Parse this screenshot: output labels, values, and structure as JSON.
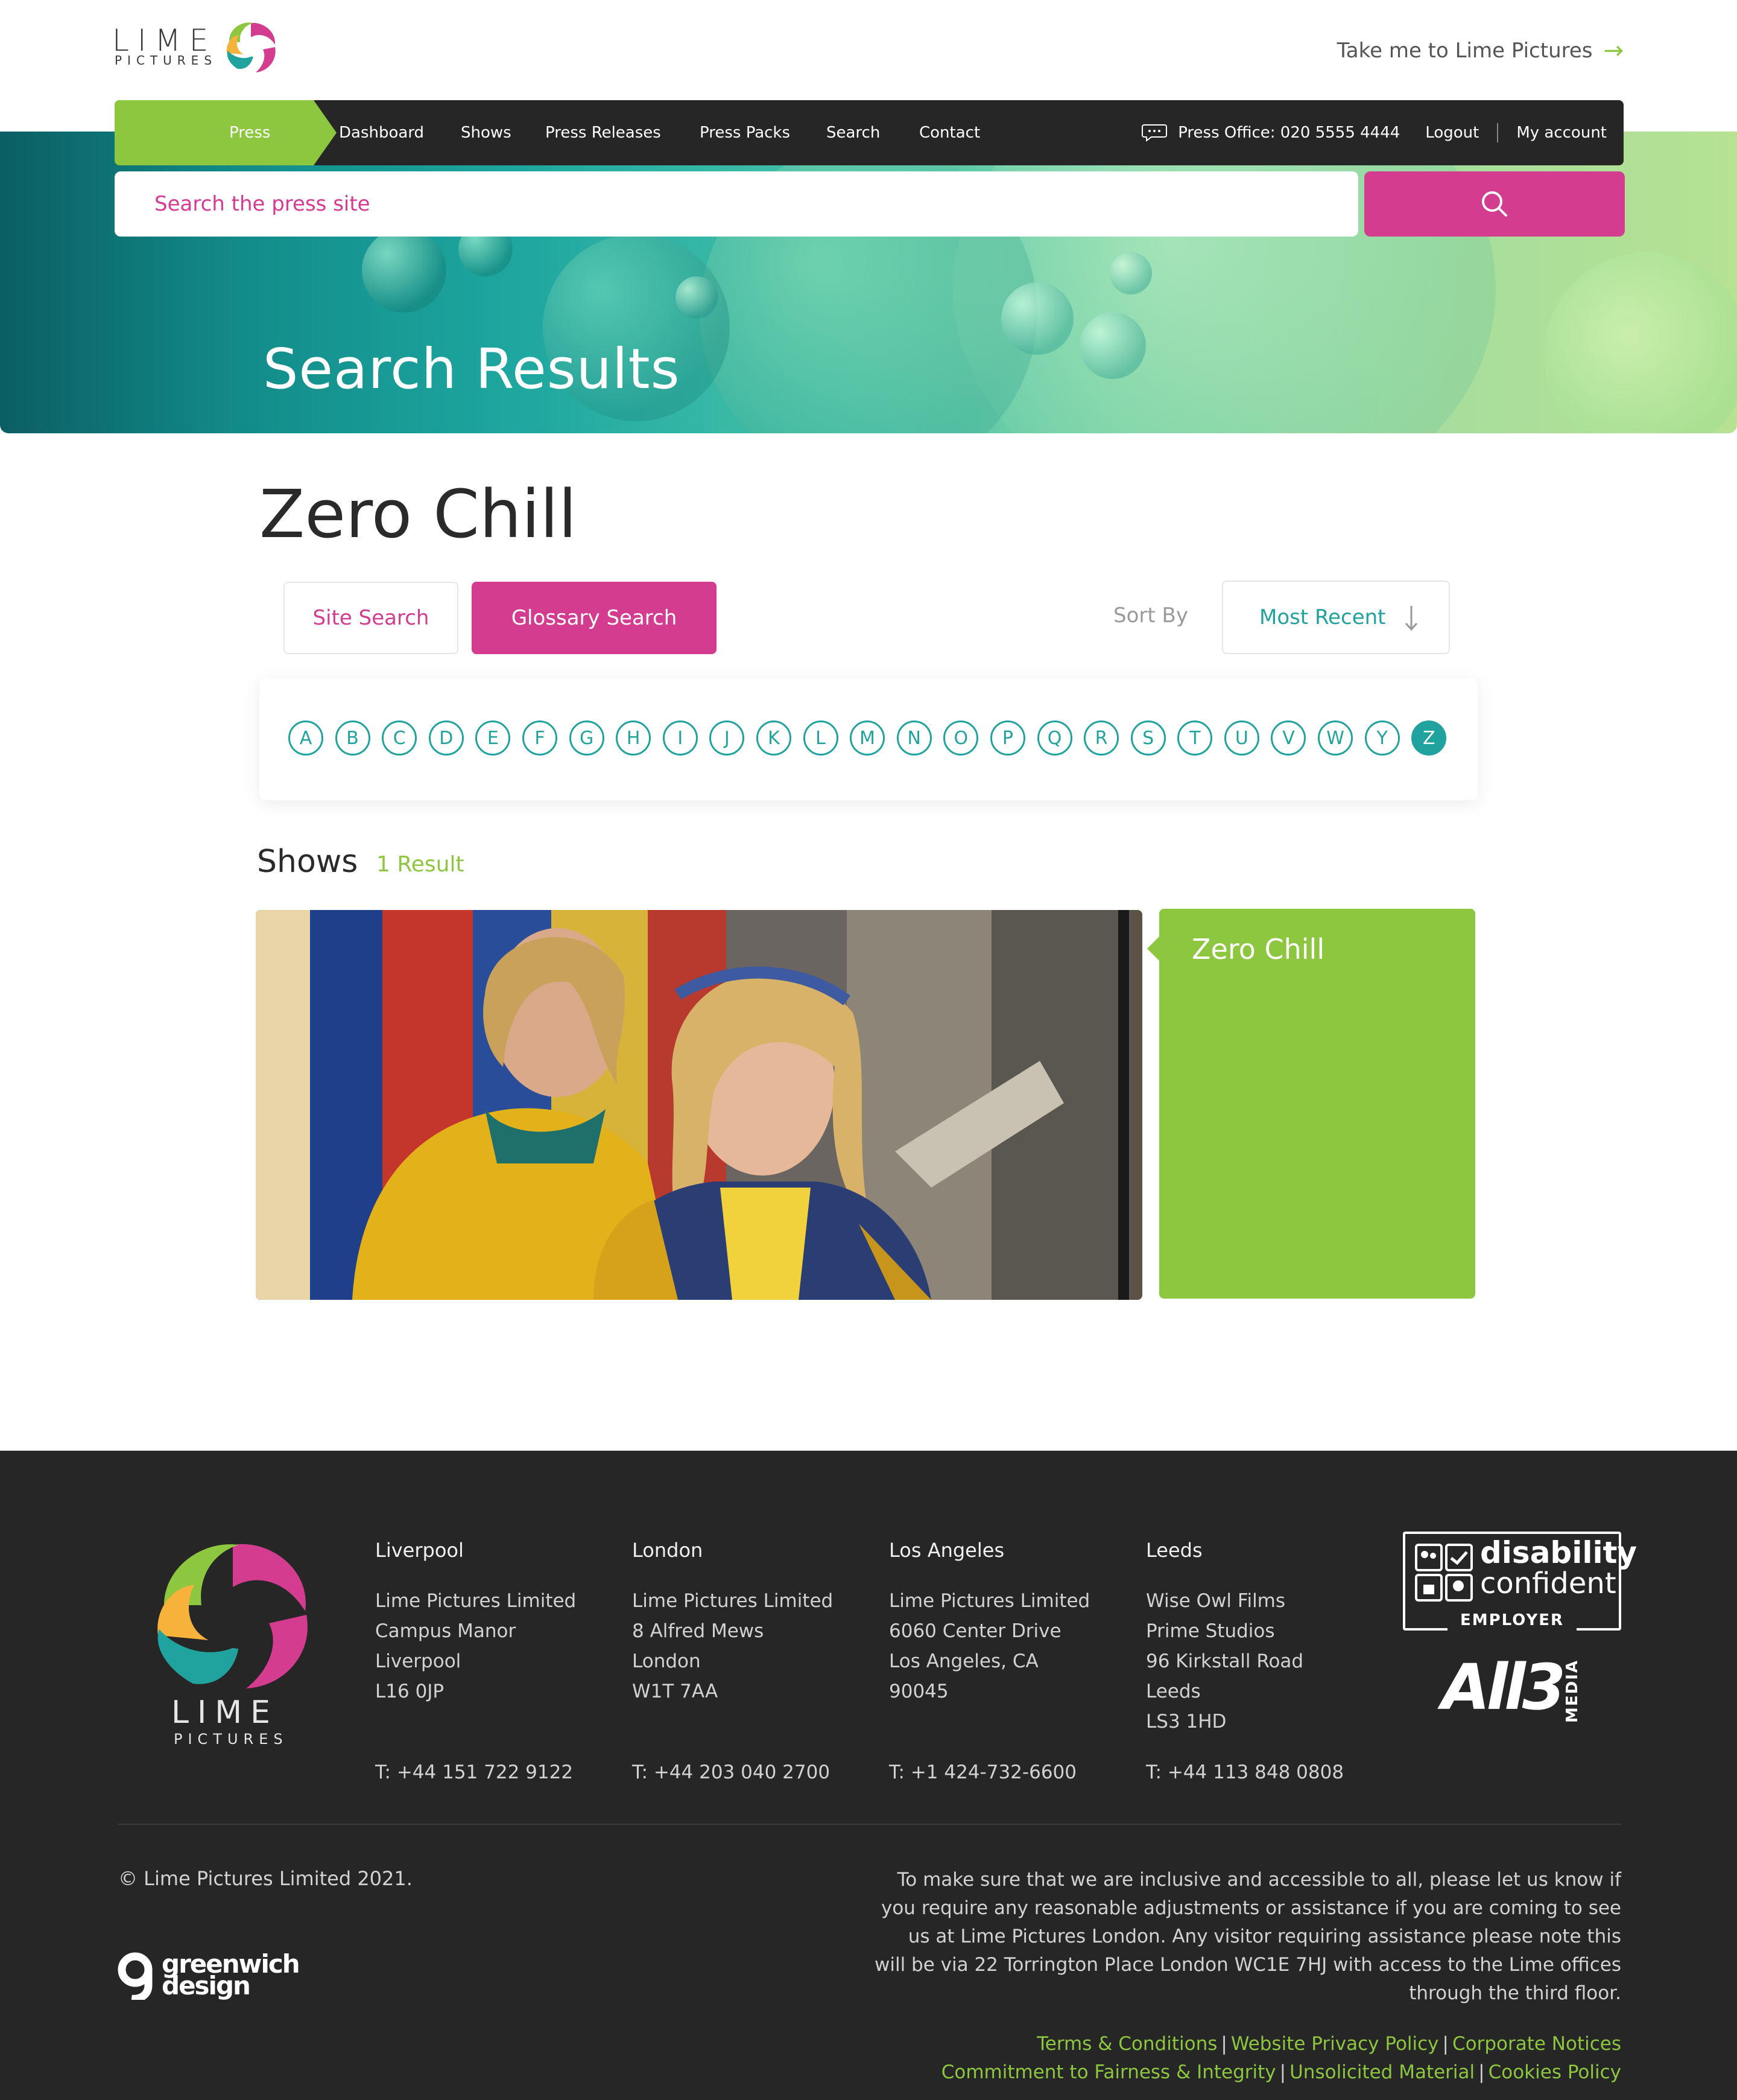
{
  "header": {
    "logo_word": "LIME",
    "logo_sub": "PICTURES",
    "take_me": "Take me to Lime Pictures"
  },
  "nav": {
    "press": "Press",
    "items": [
      "Dashboard",
      "Shows",
      "Press Releases",
      "Press Packs",
      "Search",
      "Contact"
    ],
    "press_office": "Press Office: 020 5555 4444",
    "logout": "Logout",
    "my_account": "My account"
  },
  "search": {
    "placeholder": "Search the press site"
  },
  "hero": {
    "title": "Search Results"
  },
  "results": {
    "query_title": "Zero Chill",
    "tabs": {
      "site": "Site Search",
      "glossary": "Glossary Search"
    },
    "sort_label": "Sort By",
    "sort_value": "Most Recent",
    "alphabet": [
      "A",
      "B",
      "C",
      "D",
      "E",
      "F",
      "G",
      "H",
      "I",
      "J",
      "K",
      "L",
      "M",
      "N",
      "O",
      "P",
      "Q",
      "R",
      "S",
      "T",
      "U",
      "V",
      "W",
      "Y",
      "Z"
    ],
    "active_letter": "Z",
    "section_title": "Shows",
    "result_count": "1 Result",
    "card_title": "Zero Chill"
  },
  "footer": {
    "logo_word": "LIME",
    "logo_sub": "PICTURES",
    "offices": [
      {
        "city": "Liverpool",
        "lines": [
          "Lime Pictures Limited",
          "Campus Manor",
          "Liverpool",
          "L16 0JP"
        ],
        "phone": "T: +44 151 722 9122"
      },
      {
        "city": "London",
        "lines": [
          "Lime Pictures Limited",
          "8 Alfred Mews",
          "London",
          "W1T 7AA"
        ],
        "phone": "T: +44 203 040 2700"
      },
      {
        "city": "Los Angeles",
        "lines": [
          "Lime Pictures Limited",
          "6060 Center Drive",
          "Los Angeles, CA",
          "90045"
        ],
        "phone": "T: +1 424-732-6600"
      },
      {
        "city": "Leeds",
        "lines": [
          "Wise Owl Films",
          "Prime Studios",
          "96 Kirkstall Road",
          "Leeds",
          "LS3 1HD"
        ],
        "phone": "T: +44 113 848 0808"
      }
    ],
    "badge": {
      "line1": "disability",
      "line2": "confident",
      "line3": "EMPLOYER"
    },
    "all3": {
      "word": "All3",
      "media": "MEDIA"
    },
    "copyright": "© Lime Pictures Limited 2021.",
    "greenwich": {
      "line1": "greenwich",
      "line2": "design"
    },
    "accessibility": "To make sure that we are inclusive and accessible to all, please let us know if you require any reasonable adjustments or assistance if you are coming to see us at Lime Pictures London. Any visitor requiring assistance please note this will be via 22 Torrington Place London WC1E 7HJ with access to the Lime offices through the third floor.",
    "links": [
      "Terms & Conditions",
      "Website Privacy Policy",
      "Corporate Notices",
      "Commitment to Fairness & Integrity",
      "Unsolicited Material",
      "Cookies Policy"
    ]
  },
  "colors": {
    "lime_green": "#8dc63f",
    "magenta": "#d33c8f",
    "teal": "#20a39e",
    "dark": "#262626"
  }
}
